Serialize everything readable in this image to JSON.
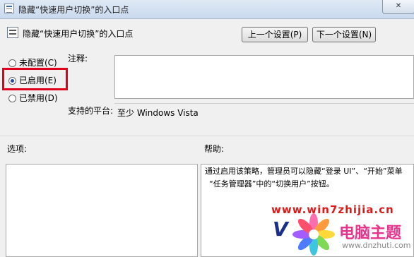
{
  "window": {
    "title": "隐藏“快速用户切换”的入口点",
    "close_label": "✕"
  },
  "policy": {
    "title": "隐藏“快速用户切换”的入口点",
    "prev_button": "上一个设置(P)",
    "next_button": "下一个设置(N)"
  },
  "state": {
    "options": [
      {
        "label": "未配置(C)",
        "selected": false
      },
      {
        "label": "已启用(E)",
        "selected": true
      },
      {
        "label": "已禁用(D)",
        "selected": false
      }
    ]
  },
  "comment": {
    "label": "注释:",
    "value": ""
  },
  "platform": {
    "label": "支持的平台:",
    "value": "至少 Windows Vista"
  },
  "options_section": {
    "label": "选项:"
  },
  "help_section": {
    "label": "帮助:",
    "text_line1": "通过启用该策略，管理员可以隐藏“登录 UI”、“开始”菜单",
    "text_line2": "“任务管理器”中的“切换用户”按钮。"
  },
  "watermark": {
    "url": "www.win7zhijia.cn",
    "v_text": "V",
    "brand": "电脑主题",
    "url2": "www.dnzhuti.com",
    "colors": {
      "red": "#e01818",
      "navy": "#1a2f8a",
      "pink": "#e8338c"
    }
  },
  "highlight_color": "#e0001b"
}
